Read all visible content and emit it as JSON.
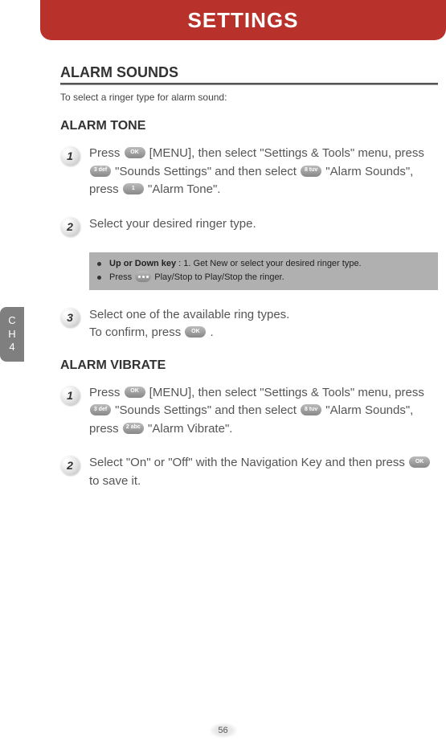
{
  "header": {
    "title": "SETTINGS"
  },
  "sidebar": {
    "line1": "C",
    "line2": "H",
    "line3": "4"
  },
  "section": {
    "title": "ALARM SOUNDS",
    "note": "To select a ringer type for alarm sound:"
  },
  "buttons": {
    "ok": "OK",
    "k3": "3 def",
    "k8": "8 tuv",
    "k1": "1",
    "k2": "2 abc"
  },
  "tone": {
    "title": "ALARM TONE",
    "steps": {
      "s1a": "Press ",
      "s1b": " [MENU], then select \"Settings & Tools\" menu, press ",
      "s1c": " \"Sounds Settings\" and then select ",
      "s1d": " \"Alarm Sounds\", press ",
      "s1e": " \"Alarm Tone\".",
      "s2": "Select your desired ringer type.",
      "s3a": "Select one of the available ring types.",
      "s3b": "To confirm, press ",
      "s3c": " ."
    },
    "tip": {
      "label": "Up or Down key",
      "rest1": " : 1. Get New or select your desired ringer type.",
      "line2a": "Press  ",
      "line2b": "  Play/Stop to Play/Stop the ringer."
    }
  },
  "vibrate": {
    "title": "ALARM VIBRATE",
    "steps": {
      "s1a": "Press ",
      "s1b": " [MENU], then select \"Settings & Tools\" menu, press ",
      "s1c": " \"Sounds Settings\" and then select ",
      "s1d": " \"Alarm Sounds\", press ",
      "s1e": " \"Alarm Vibrate\".",
      "s2a": "Select \"On\" or \"Off\" with the Navigation Key and then press ",
      "s2b": " to save it."
    }
  },
  "page": {
    "number": "56"
  }
}
